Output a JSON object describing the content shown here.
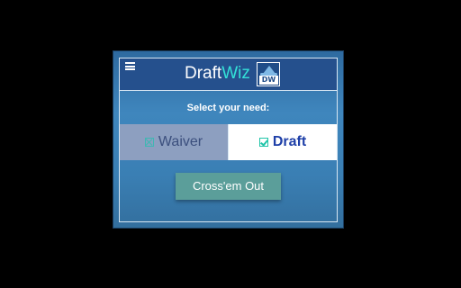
{
  "header": {
    "title_main": "Draft",
    "title_accent": "Wiz",
    "logo_text": "DW",
    "menu_icon": "hamburger-menu-icon"
  },
  "prompt": "Select your need:",
  "options": {
    "waiver": {
      "label": "Waiver",
      "icon": "x-box-icon",
      "selected": false
    },
    "draft": {
      "label": "Draft",
      "icon": "check-box-icon",
      "selected": true
    }
  },
  "action_button": {
    "label": "Cross'em Out"
  },
  "colors": {
    "header_bg": "#25508d",
    "accent": "#33e1d8",
    "selected_text": "#1e3fa8",
    "button_bg": "#5b9e9a"
  }
}
